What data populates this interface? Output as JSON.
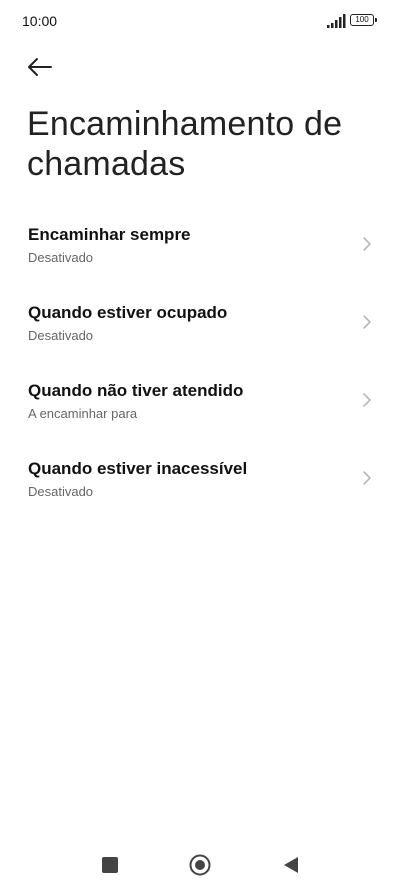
{
  "status_bar": {
    "time": "10:00",
    "battery": "100"
  },
  "header": {
    "back_icon": "arrow-left-icon",
    "title": "Encaminhamento de chamadas"
  },
  "settings": [
    {
      "title": "Encaminhar sempre",
      "subtitle": "Desativado"
    },
    {
      "title": "Quando estiver ocupado",
      "subtitle": "Desativado"
    },
    {
      "title": "Quando não tiver atendido",
      "subtitle": "A encaminhar para"
    },
    {
      "title": "Quando estiver inacessível",
      "subtitle": "Desativado"
    }
  ],
  "nav": {
    "recents_icon": "square-icon",
    "home_icon": "circle-icon",
    "back_icon": "triangle-back-icon"
  }
}
